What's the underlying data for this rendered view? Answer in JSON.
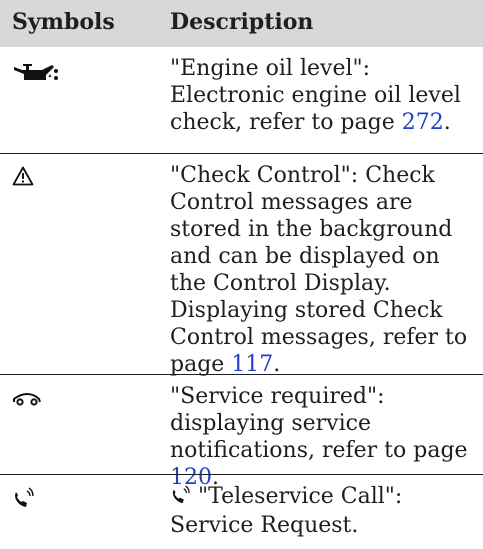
{
  "header": {
    "symbols_label": "Symbols",
    "description_label": "Description"
  },
  "rows": [
    {
      "icon": "engine-oil-level-icon",
      "text": "\"Engine oil level\": Electronic engine oil level check, refer to page ",
      "page": "272",
      "suffix": "."
    },
    {
      "icon": "warning-triangle-icon",
      "text": "\"Check Control\": Check Control messages are stored in the background and can be displayed on the Control Display. Displaying stored Check Control messages, refer to page ",
      "page": "117",
      "suffix": "."
    },
    {
      "icon": "vehicle-service-icon",
      "text": "\"Service required\": displaying service notifications, refer to page ",
      "page": "120",
      "suffix": "."
    },
    {
      "icon": "teleservice-call-icon",
      "text": "\"Teleservice Call\": Service Request.",
      "page": "",
      "suffix": ""
    }
  ]
}
